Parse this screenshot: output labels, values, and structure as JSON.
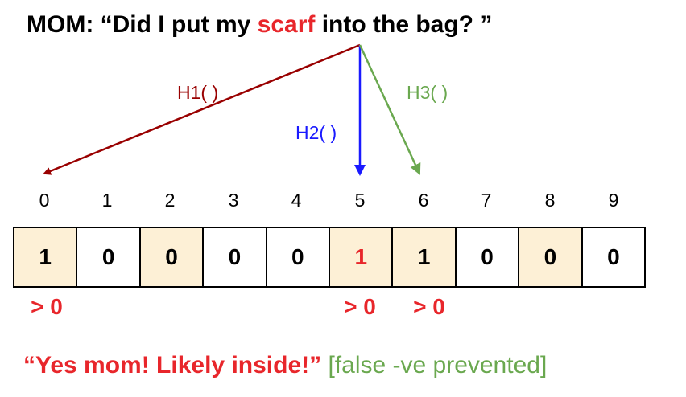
{
  "question": {
    "prefix": "MOM: “Did I put my ",
    "keyword": "scarf",
    "suffix": " into the bag? ”"
  },
  "hash_functions": [
    {
      "label": "H1( )",
      "target_index": 0,
      "color": "#990000"
    },
    {
      "label": "H2( )",
      "target_index": 5,
      "color": "#1a1aff"
    },
    {
      "label": "H3( )",
      "target_index": 6,
      "color": "#6aa84f"
    }
  ],
  "indices": [
    "0",
    "1",
    "2",
    "3",
    "4",
    "5",
    "6",
    "7",
    "8",
    "9"
  ],
  "bits": [
    "1",
    "0",
    "0",
    "0",
    "0",
    "1",
    "1",
    "0",
    "0",
    "0"
  ],
  "highlighted_cells": [
    0,
    2,
    5,
    6,
    8
  ],
  "red_value_cells": [
    5
  ],
  "check_labels": [
    {
      "cell": 0,
      "text": "> 0"
    },
    {
      "cell": 5,
      "text": "> 0"
    },
    {
      "cell": 6,
      "text": "> 0"
    }
  ],
  "answer": {
    "text": "“Yes mom! Likely inside!”",
    "note": "[false -ve prevented]"
  },
  "colors": {
    "accent_red": "#e8262b",
    "cell_highlight": "#fdf0d6"
  }
}
